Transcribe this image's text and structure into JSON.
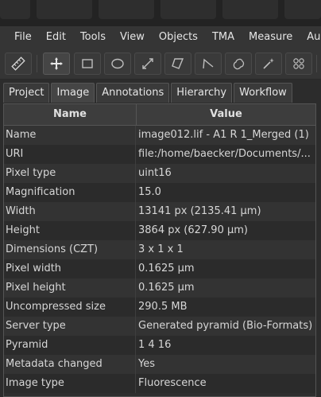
{
  "menu": [
    "File",
    "Edit",
    "Tools",
    "View",
    "Objects",
    "TMA",
    "Measure",
    "Au"
  ],
  "toolbar_icons": [
    "ruler-icon",
    "move-icon",
    "rectangle-icon",
    "ellipse-icon",
    "line-icon",
    "polygon-icon",
    "polyline-icon",
    "brush-icon",
    "wand-icon",
    "points-icon"
  ],
  "tabs": [
    "Project",
    "Image",
    "Annotations",
    "Hierarchy",
    "Workflow"
  ],
  "selected_tab": "Image",
  "table": {
    "headers": [
      "Name",
      "Value"
    ],
    "rows": [
      [
        "Name",
        "image012.lif - A1 R 1_Merged (1)"
      ],
      [
        "URI",
        "file:/home/baecker/Documents/..."
      ],
      [
        "Pixel type",
        "uint16"
      ],
      [
        "Magnification",
        "15.0"
      ],
      [
        "Width",
        "13141 px (2135.41 µm)"
      ],
      [
        "Height",
        "3864 px (627.90 µm)"
      ],
      [
        "Dimensions (CZT)",
        "3 x 1 x 1"
      ],
      [
        "Pixel width",
        "0.1625 µm"
      ],
      [
        "Pixel height",
        "0.1625 µm"
      ],
      [
        "Uncompressed size",
        "290.5 MB"
      ],
      [
        "Server type",
        "Generated pyramid (Bio-Formats)"
      ],
      [
        "Pyramid",
        "1 4 16"
      ],
      [
        "Metadata changed",
        "Yes"
      ],
      [
        "Image type",
        "Fluorescence"
      ]
    ]
  }
}
